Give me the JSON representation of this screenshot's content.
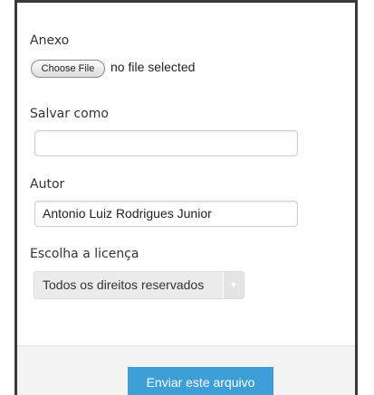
{
  "form": {
    "attachment": {
      "label": "Anexo",
      "button_label": "Choose File",
      "status": "no file selected"
    },
    "save_as": {
      "label": "Salvar como",
      "value": ""
    },
    "author": {
      "label": "Autor",
      "value": "Antonio Luiz Rodrigues Junior"
    },
    "license": {
      "label": "Escolha a licença",
      "selected": "Todos os direitos reservados"
    },
    "submit_label": "Enviar este arquivo"
  }
}
